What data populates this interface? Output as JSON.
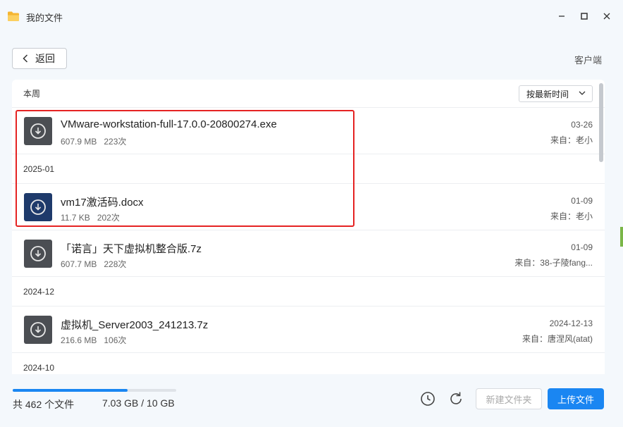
{
  "window": {
    "title": "我的文件"
  },
  "nav": {
    "back_label": "返回",
    "client_label": "客户端"
  },
  "section": {
    "title": "本周",
    "sort_label": "按最新时间"
  },
  "groups": [
    {
      "label": "",
      "items": [
        {
          "name": "VMware-workstation-full-17.0.0-20800274.exe",
          "size": "607.9 MB",
          "count": "223次",
          "date": "03-26",
          "from": "来自：老小",
          "icon": "download-icon"
        }
      ]
    },
    {
      "label": "2025-01",
      "items": [
        {
          "name": "vm17激活码.docx",
          "size": "11.7 KB",
          "count": "202次",
          "date": "01-09",
          "from": "来自：老小",
          "icon": "download-icon"
        },
        {
          "name": "「诺言」天下虚拟机整合版.7z",
          "size": "607.7 MB",
          "count": "228次",
          "date": "01-09",
          "from": "来自：38-子陵fang...",
          "icon": "download-icon"
        }
      ]
    },
    {
      "label": "2024-12",
      "items": [
        {
          "name": "虚拟机_Server2003_241213.7z",
          "size": "216.6 MB",
          "count": "106次",
          "date": "2024-12-13",
          "from": "来自：唐涅风(atat)",
          "icon": "download-icon"
        }
      ]
    },
    {
      "label": "2024-10",
      "items": []
    }
  ],
  "footer": {
    "file_count": "共 462 个文件",
    "quota": "7.03 GB / 10 GB",
    "quota_fraction": 0.703,
    "new_folder_label": "新建文件夹",
    "upload_label": "上传文件"
  },
  "colors": {
    "accent": "#1a86f2",
    "highlight": "#e52323"
  }
}
